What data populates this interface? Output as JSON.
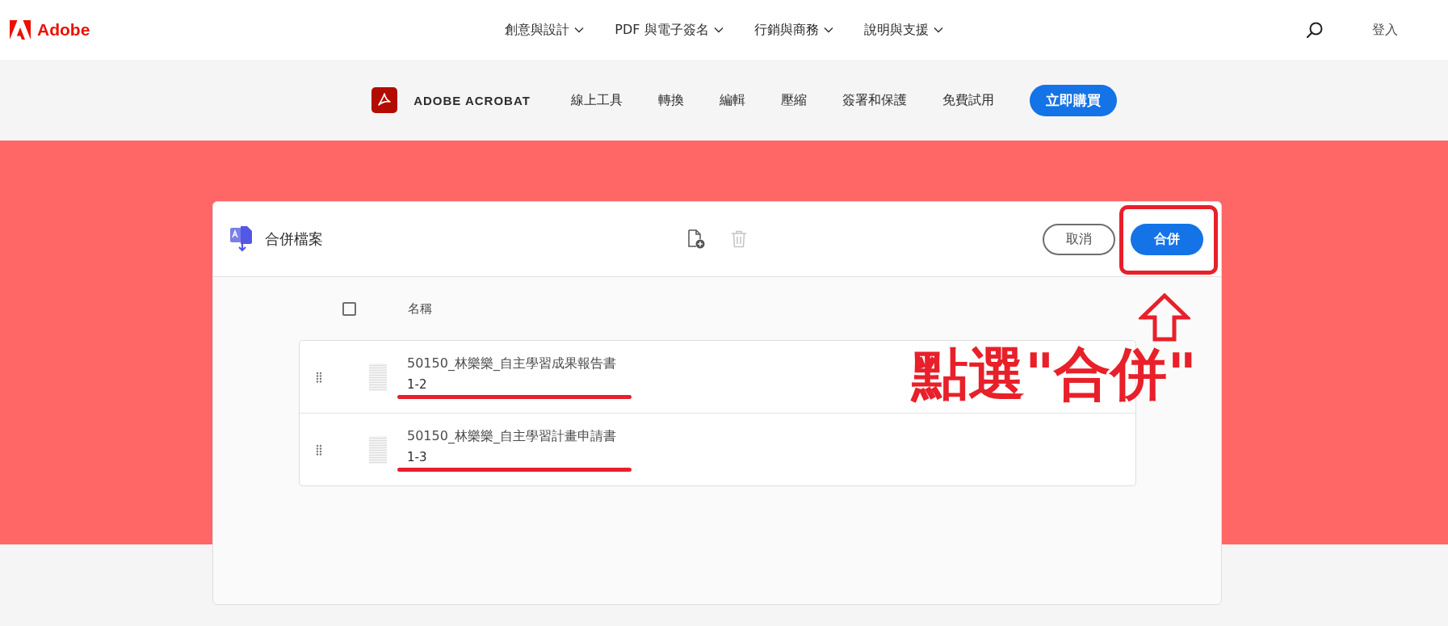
{
  "global_nav": {
    "brand": "Adobe",
    "items": [
      {
        "label": "創意與設計",
        "dropdown": true
      },
      {
        "label": "PDF 與電子簽名",
        "dropdown": true
      },
      {
        "label": "行銷與商務",
        "dropdown": true
      },
      {
        "label": "說明與支援",
        "dropdown": true
      }
    ],
    "sign_in": "登入"
  },
  "product_nav": {
    "product": "ADOBE ACROBAT",
    "items": [
      "線上工具",
      "轉換",
      "編輯",
      "壓縮",
      "簽署和保護",
      "免費試用"
    ],
    "buy_button": "立即購買"
  },
  "panel": {
    "title": "合併檔案",
    "cancel_button": "取消",
    "merge_button": "合併",
    "select_all": {
      "checked": false
    },
    "column_header": "名稱",
    "files": [
      {
        "name": "50150_林樂樂_自主學習成果報告書",
        "pages": "1-2"
      },
      {
        "name": "50150_林樂樂_自主學習計畫申請書",
        "pages": "1-3"
      }
    ]
  },
  "annotation": {
    "text": "點選\"合併\""
  }
}
